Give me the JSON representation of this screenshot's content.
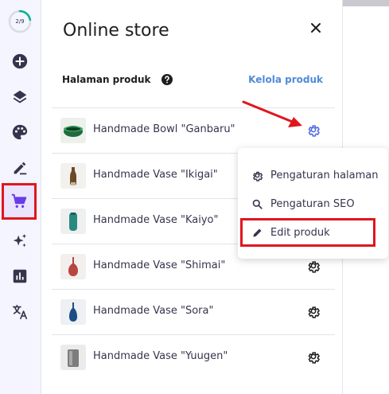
{
  "rail": {
    "progress_label": "2/9",
    "progress_fraction": 0.222,
    "items": [
      {
        "icon": "add-icon"
      },
      {
        "icon": "layers-icon"
      },
      {
        "icon": "palette-icon"
      },
      {
        "icon": "edit-icon"
      },
      {
        "icon": "cart-icon",
        "active": true
      },
      {
        "icon": "sparkle-icon"
      },
      {
        "icon": "analytics-icon"
      },
      {
        "icon": "translate-icon"
      }
    ]
  },
  "panel": {
    "title": "Online store",
    "section_label": "Halaman produk",
    "manage_link": "Kelola produk",
    "products": [
      {
        "name": "Handmade Bowl \"Ganbaru\""
      },
      {
        "name": "Handmade Vase \"Ikigai\""
      },
      {
        "name": "Handmade Vase \"Kaiyo\""
      },
      {
        "name": "Handmade Vase \"Shimai\""
      },
      {
        "name": "Handmade Vase \"Sora\""
      },
      {
        "name": "Handmade Vase \"Yuugen\""
      }
    ]
  },
  "context_menu": {
    "items": [
      {
        "label": "Pengaturan halaman",
        "icon": "gear-icon"
      },
      {
        "label": "Pengaturan SEO",
        "icon": "search-icon"
      },
      {
        "label": "Edit produk",
        "icon": "pencil-icon"
      }
    ]
  },
  "colors": {
    "accent": "#673de6",
    "link": "#4f8bd9",
    "annotation": "#e0161e",
    "progress": "#00b090"
  }
}
